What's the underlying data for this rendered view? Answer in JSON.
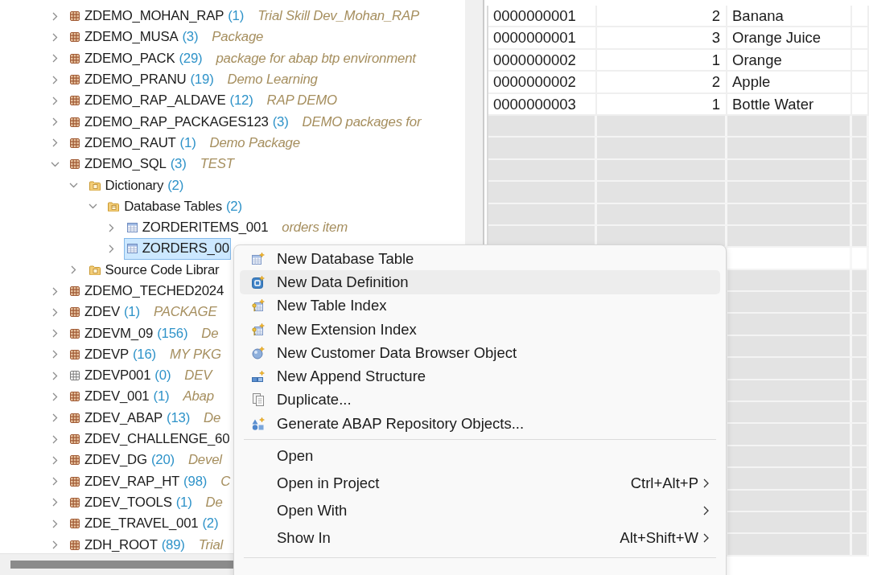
{
  "tree": {
    "nodes": [
      {
        "kind": "package",
        "name": "ZDEMO_MOHAN_RAP",
        "count": "(1)",
        "description": "Trial Skill Dev_Mohan_RAP",
        "expanded": false,
        "selected": false
      },
      {
        "kind": "package",
        "name": "ZDEMO_MUSA",
        "count": "(3)",
        "description": "Package",
        "expanded": false,
        "selected": false
      },
      {
        "kind": "package",
        "name": "ZDEMO_PACK",
        "count": "(29)",
        "description": "package for abap btp environment",
        "expanded": false,
        "selected": false
      },
      {
        "kind": "package",
        "name": "ZDEMO_PRANU",
        "count": "(19)",
        "description": "Demo Learning",
        "expanded": false,
        "selected": false
      },
      {
        "kind": "package",
        "name": "ZDEMO_RAP_ALDAVE",
        "count": "(12)",
        "description": "RAP DEMO",
        "expanded": false,
        "selected": false
      },
      {
        "kind": "package",
        "name": "ZDEMO_RAP_PACKAGES123",
        "count": "(3)",
        "description": "DEMO packages for",
        "expanded": false,
        "selected": false
      },
      {
        "kind": "package",
        "name": "ZDEMO_RAUT",
        "count": "(1)",
        "description": "Demo Package",
        "expanded": false,
        "selected": false
      },
      {
        "kind": "package",
        "name": "ZDEMO_SQL",
        "count": "(3)",
        "description": "TEST",
        "expanded": true,
        "selected": false,
        "children": [
          {
            "kind": "folder",
            "name": "Dictionary",
            "count": "(2)",
            "expanded": true,
            "selected": false,
            "children": [
              {
                "kind": "table-folder",
                "name": "Database Tables",
                "count": "(2)",
                "expanded": true,
                "selected": false,
                "children": [
                  {
                    "kind": "table",
                    "name": "ZORDERITEMS_001",
                    "description": "orders item",
                    "expanded": false,
                    "selected": false
                  },
                  {
                    "kind": "table",
                    "name": "ZORDERS_00",
                    "expanded": false,
                    "selected": true
                  }
                ]
              }
            ]
          },
          {
            "kind": "folder",
            "name": "Source Code Librar",
            "expanded": false,
            "selected": false
          }
        ]
      },
      {
        "kind": "package",
        "name": "ZDEMO_TECHED2024",
        "expanded": false,
        "selected": false
      },
      {
        "kind": "package",
        "name": "ZDEV",
        "count": "(1)",
        "description": "PACKAGE",
        "expanded": false,
        "selected": false
      },
      {
        "kind": "package",
        "name": "ZDEVM_09",
        "count": "(156)",
        "description": "De",
        "expanded": false,
        "selected": false
      },
      {
        "kind": "package",
        "name": "ZDEVP",
        "count": "(16)",
        "description": "MY PKG",
        "expanded": false,
        "selected": false
      },
      {
        "kind": "empty-package",
        "name": "ZDEVP001",
        "count": "(0)",
        "description": "DEV",
        "expanded": false,
        "selected": false
      },
      {
        "kind": "package",
        "name": "ZDEV_001",
        "count": "(1)",
        "description": "Abap",
        "expanded": false,
        "selected": false
      },
      {
        "kind": "package",
        "name": "ZDEV_ABAP",
        "count": "(13)",
        "description": "De",
        "expanded": false,
        "selected": false
      },
      {
        "kind": "package",
        "name": "ZDEV_CHALLENGE_60",
        "expanded": false,
        "selected": false
      },
      {
        "kind": "package",
        "name": "ZDEV_DG",
        "count": "(20)",
        "description": "Devel",
        "expanded": false,
        "selected": false
      },
      {
        "kind": "package",
        "name": "ZDEV_RAP_HT",
        "count": "(98)",
        "description": "C",
        "expanded": false,
        "selected": false
      },
      {
        "kind": "package",
        "name": "ZDEV_TOOLS",
        "count": "(1)",
        "description": "De",
        "expanded": false,
        "selected": false
      },
      {
        "kind": "package",
        "name": "ZDE_TRAVEL_001",
        "count": "(2)",
        "expanded": false,
        "selected": false
      },
      {
        "kind": "package",
        "name": "ZDH_ROOT",
        "count": "(89)",
        "description": "Trial",
        "expanded": false,
        "selected": false
      }
    ]
  },
  "table": {
    "rows": [
      [
        "0000000001",
        "2",
        "Banana"
      ],
      [
        "0000000001",
        "3",
        "Orange Juice"
      ],
      [
        "0000000002",
        "1",
        "Orange"
      ],
      [
        "0000000002",
        "2",
        "Apple"
      ],
      [
        "0000000003",
        "1",
        "Bottle Water"
      ]
    ]
  },
  "context_menu": {
    "groups": [
      [
        {
          "label": "New Database Table",
          "hovered": false,
          "submenu": false
        },
        {
          "label": "New Data Definition",
          "hovered": true,
          "submenu": false
        },
        {
          "label": "New Table Index",
          "hovered": false,
          "submenu": false
        },
        {
          "label": "New Extension Index",
          "hovered": false,
          "submenu": false
        },
        {
          "label": "New Customer Data Browser Object",
          "hovered": false,
          "submenu": false
        },
        {
          "label": "New Append Structure",
          "hovered": false,
          "submenu": false
        },
        {
          "label": "Duplicate...",
          "hovered": false,
          "submenu": false
        },
        {
          "label": "Generate ABAP Repository Objects...",
          "hovered": false,
          "submenu": false
        }
      ],
      [
        {
          "label": "Open",
          "hovered": false,
          "submenu": false
        },
        {
          "label": "Open in Project",
          "shortcut": "Ctrl+Alt+P",
          "hovered": false,
          "submenu": true
        },
        {
          "label": "Open With",
          "hovered": false,
          "submenu": true
        },
        {
          "label": "Show In",
          "shortcut": "Alt+Shift+W",
          "hovered": false,
          "submenu": true
        }
      ]
    ]
  }
}
